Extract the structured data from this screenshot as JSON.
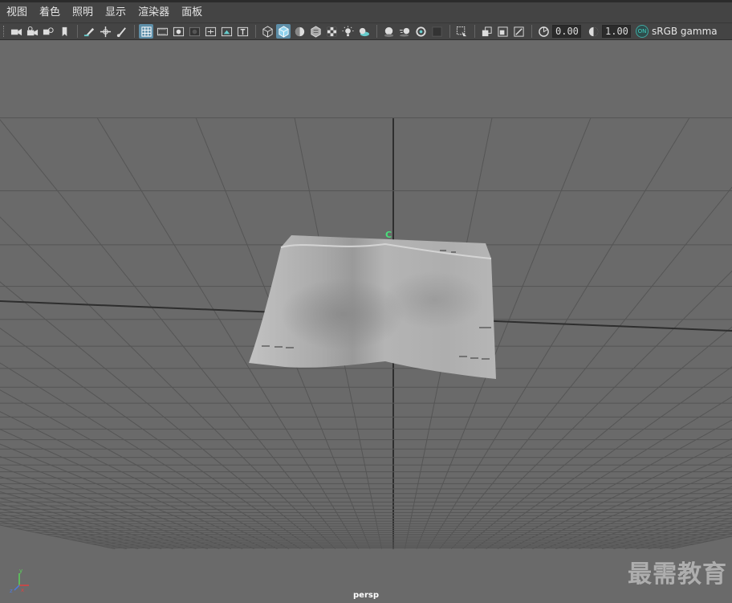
{
  "menubar": {
    "items": [
      "视图",
      "着色",
      "照明",
      "显示",
      "渲染器",
      "面板"
    ]
  },
  "toolbar": {
    "exposure_value": "0.00",
    "gamma_value": "1.00",
    "color_management_badge": "ON",
    "color_space": "sRGB gamma",
    "icons": [
      "select-camera-icon",
      "camera-attributes-icon",
      "bookmark-icon",
      "image-plane-icon",
      "grid-toggle-icon",
      "film-gate-icon",
      "resolution-gate-icon",
      "gate-mask-icon",
      "field-chart-icon",
      "safe-action-icon",
      "safe-title-icon",
      "wireframe-icon",
      "smooth-shade-icon",
      "flat-shade-icon",
      "bounding-box-icon",
      "textured-icon",
      "use-lights-icon",
      "shadows-icon",
      "screen-space-ao-icon",
      "motion-blur-icon",
      "anti-aliasing-icon",
      "depth-of-field-icon",
      "isolate-select-icon",
      "xray-icon",
      "xray-joints-icon",
      "xray-active-icon",
      "exposure-icon",
      "gamma-icon"
    ]
  },
  "viewport": {
    "camera_label": "persp",
    "cluster_handle_label": "C",
    "axis_labels": {
      "x": "x",
      "y": "y",
      "z": "z"
    },
    "watermark": "最需教育"
  },
  "colors": {
    "background": "#6a6a6a",
    "grid_line": "#555555",
    "grid_axis": "#2e2e2e",
    "cloth": "#b8b8b8",
    "accent": "#5d8ea8"
  }
}
